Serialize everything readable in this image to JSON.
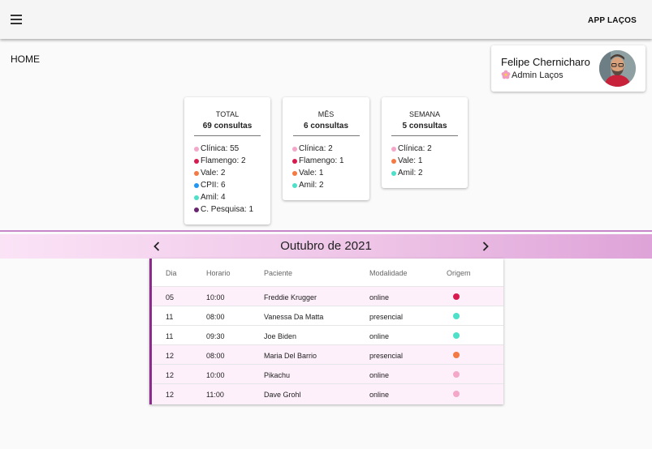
{
  "header": {
    "app_title": "APP LAÇOS",
    "menu_icon": "menu-icon"
  },
  "page": {
    "title": "HOME"
  },
  "profile": {
    "name": "Felipe Chernicharo",
    "role": "Admin Laços",
    "role_icon": "flower-icon"
  },
  "colors": {
    "Clínica": "#f4a7c9",
    "Flamengo": "#d81b4f",
    "Vale": "#f47a45",
    "CPII": "#2196f3",
    "Amil": "#4ee0c8",
    "C. Pesquisa": "#6a2470",
    "accent": "#8e2a8e"
  },
  "stats": [
    {
      "period": "TOTAL",
      "count": "69 consultas",
      "items": [
        {
          "label": "Clínica: 55",
          "color": "#f4a7c9"
        },
        {
          "label": "Flamengo: 2",
          "color": "#d81b4f"
        },
        {
          "label": "Vale: 2",
          "color": "#f47a45"
        },
        {
          "label": "CPII: 6",
          "color": "#2196f3"
        },
        {
          "label": "Amil: 4",
          "color": "#4ee0c8"
        },
        {
          "label": "C. Pesquisa: 1",
          "color": "#6a2470"
        }
      ]
    },
    {
      "period": "MÊS",
      "count": "6 consultas",
      "items": [
        {
          "label": "Clínica: 2",
          "color": "#f4a7c9"
        },
        {
          "label": "Flamengo: 1",
          "color": "#d81b4f"
        },
        {
          "label": "Vale: 1",
          "color": "#f47a45"
        },
        {
          "label": "Amil: 2",
          "color": "#4ee0c8"
        }
      ]
    },
    {
      "period": "SEMANA",
      "count": "5 consultas",
      "items": [
        {
          "label": "Clínica: 2",
          "color": "#f4a7c9"
        },
        {
          "label": "Vale: 1",
          "color": "#f47a45"
        },
        {
          "label": "Amil: 2",
          "color": "#4ee0c8"
        }
      ]
    }
  ],
  "calendar": {
    "month_label": "Outubro de 2021",
    "prev_icon": "chevron-left-icon",
    "next_icon": "chevron-right-icon"
  },
  "table": {
    "columns": [
      "Dia",
      "Horario",
      "Paciente",
      "Modalidade",
      "Origem"
    ],
    "rows": [
      {
        "dia": "05",
        "horario": "10:00",
        "paciente": "Freddie Krugger",
        "modalidade": "online",
        "origem_color": "#d81b4f"
      },
      {
        "dia": "11",
        "horario": "08:00",
        "paciente": "Vanessa Da Matta",
        "modalidade": "presencial",
        "origem_color": "#4ee0c8"
      },
      {
        "dia": "11",
        "horario": "09:30",
        "paciente": "Joe Biden",
        "modalidade": "online",
        "origem_color": "#4ee0c8"
      },
      {
        "dia": "12",
        "horario": "08:00",
        "paciente": "Maria Del Barrio",
        "modalidade": "presencial",
        "origem_color": "#f47a45"
      },
      {
        "dia": "12",
        "horario": "10:00",
        "paciente": "Pikachu",
        "modalidade": "online",
        "origem_color": "#f4a7c9"
      },
      {
        "dia": "12",
        "horario": "11:00",
        "paciente": "Dave Grohl",
        "modalidade": "online",
        "origem_color": "#f4a7c9"
      }
    ]
  }
}
